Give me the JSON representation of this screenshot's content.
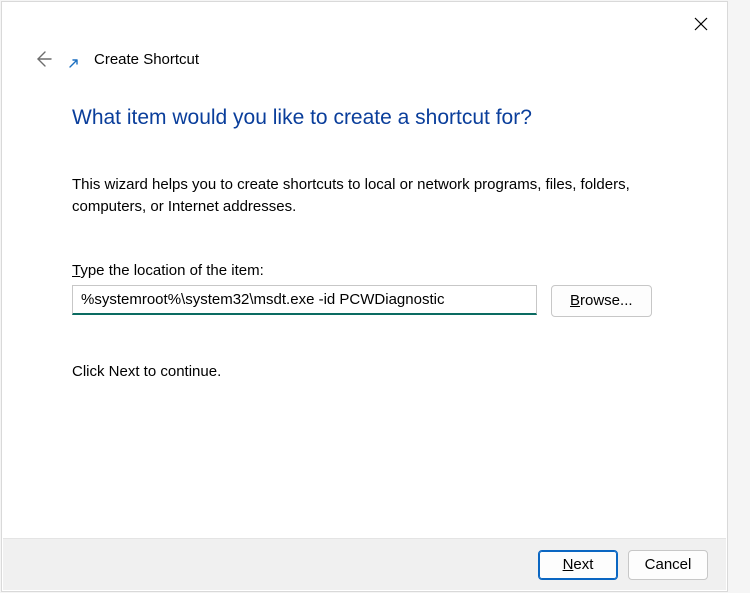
{
  "window": {
    "title": "Create Shortcut"
  },
  "heading": "What item would you like to create a shortcut for?",
  "description": "This wizard helps you to create shortcuts to local or network programs, files, folders, computers, or Internet addresses.",
  "field": {
    "label_prefix": "T",
    "label_rest": "ype the location of the item:",
    "value": "%systemroot%\\system32\\msdt.exe -id PCWDiagnostic"
  },
  "buttons": {
    "browse_prefix": "B",
    "browse_rest": "rowse...",
    "next_prefix": "N",
    "next_rest": "ext",
    "cancel": "Cancel"
  },
  "continue_text": "Click Next to continue."
}
